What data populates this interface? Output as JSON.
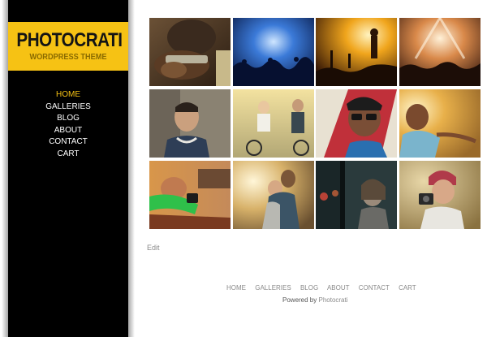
{
  "logo": {
    "title": "PHOTOCRATI",
    "subtitle": "WORDPRESS THEME"
  },
  "sidebar_menu": [
    {
      "label": "HOME",
      "active": true
    },
    {
      "label": "GALLERIES",
      "active": false
    },
    {
      "label": "BLOG",
      "active": false
    },
    {
      "label": "ABOUT",
      "active": false
    },
    {
      "label": "CONTACT",
      "active": false
    },
    {
      "label": "CART",
      "active": false
    }
  ],
  "gallery": {
    "images": [
      {
        "subject": "harmonica player"
      },
      {
        "subject": "blue concert crowd"
      },
      {
        "subject": "concert silhouette"
      },
      {
        "subject": "stage lights crowd"
      },
      {
        "subject": "smiling man with headphones"
      },
      {
        "subject": "couple on bicycles"
      },
      {
        "subject": "woman in sunglasses"
      },
      {
        "subject": "woman in sunlight"
      },
      {
        "subject": "woman in car window"
      },
      {
        "subject": "couple embracing"
      },
      {
        "subject": "woman at night window"
      },
      {
        "subject": "woman with camera"
      }
    ]
  },
  "edit_link": "Edit",
  "footer": {
    "nav": [
      "HOME",
      "GALLERIES",
      "BLOG",
      "ABOUT",
      "CONTACT",
      "CART"
    ],
    "powered_prefix": "Powered by",
    "powered_link": "Photocrati"
  },
  "colors": {
    "accent": "#f6c214",
    "sidebar": "#000000",
    "text_muted": "#8a8a8a"
  }
}
